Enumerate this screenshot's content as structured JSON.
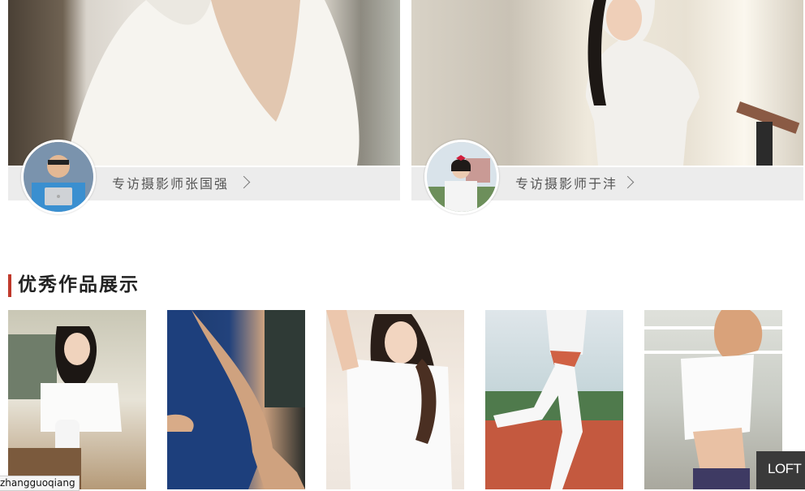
{
  "interviews": [
    {
      "label": "专访摄影师张国强",
      "avatar": "photographer-avatar"
    },
    {
      "label": "专访摄影师于沣",
      "avatar": "photographer-avatar"
    }
  ],
  "section": {
    "title": "优秀作品展示"
  },
  "status_tip": "zhangguoqiang",
  "badge": "LOFT",
  "colors": {
    "accent": "#c0392b",
    "bar": "#ececec"
  }
}
